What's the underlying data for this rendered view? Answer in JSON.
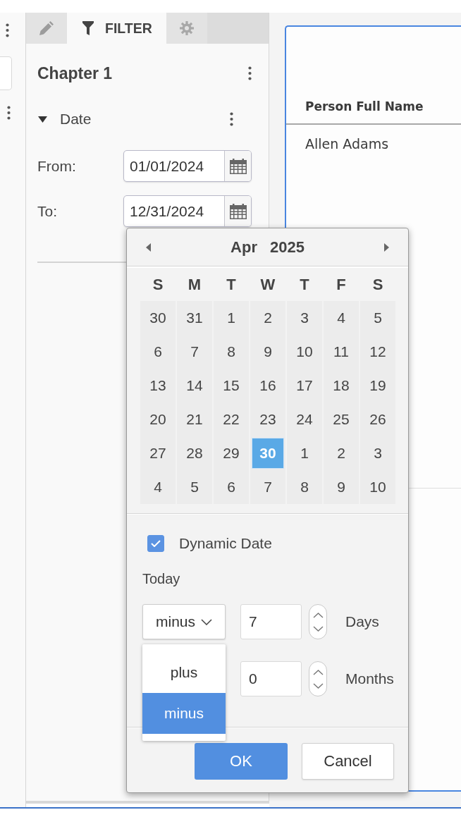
{
  "tabs": [
    {
      "kind": "edit",
      "selected": false
    },
    {
      "kind": "filter",
      "label": "FILTER",
      "selected": true
    },
    {
      "kind": "settings",
      "selected": false
    }
  ],
  "filter_panel": {
    "title": "Chapter 1",
    "section": {
      "label": "Date",
      "expanded": true
    },
    "fields": [
      {
        "label": "From:",
        "value": "01/01/2024"
      },
      {
        "label": "To:",
        "value": "12/31/2024"
      }
    ]
  },
  "table": {
    "columns": [
      "Person Full Name"
    ],
    "rows": [
      [
        "Allen Adams"
      ]
    ]
  },
  "date_picker": {
    "month": "Apr",
    "year": "2025",
    "weekdays": [
      "S",
      "M",
      "T",
      "W",
      "T",
      "F",
      "S"
    ],
    "weeks": [
      [
        {
          "day": "30",
          "selected": false
        },
        {
          "day": "31",
          "selected": false
        },
        {
          "day": "1",
          "selected": false
        },
        {
          "day": "2",
          "selected": false
        },
        {
          "day": "3",
          "selected": false
        },
        {
          "day": "4",
          "selected": false
        },
        {
          "day": "5",
          "selected": false
        }
      ],
      [
        {
          "day": "6",
          "selected": false
        },
        {
          "day": "7",
          "selected": false
        },
        {
          "day": "8",
          "selected": false
        },
        {
          "day": "9",
          "selected": false
        },
        {
          "day": "10",
          "selected": false
        },
        {
          "day": "11",
          "selected": false
        },
        {
          "day": "12",
          "selected": false
        }
      ],
      [
        {
          "day": "13",
          "selected": false
        },
        {
          "day": "14",
          "selected": false
        },
        {
          "day": "15",
          "selected": false
        },
        {
          "day": "16",
          "selected": false
        },
        {
          "day": "17",
          "selected": false
        },
        {
          "day": "18",
          "selected": false
        },
        {
          "day": "19",
          "selected": false
        }
      ],
      [
        {
          "day": "20",
          "selected": false
        },
        {
          "day": "21",
          "selected": false
        },
        {
          "day": "22",
          "selected": false
        },
        {
          "day": "23",
          "selected": false
        },
        {
          "day": "24",
          "selected": false
        },
        {
          "day": "25",
          "selected": false
        },
        {
          "day": "26",
          "selected": false
        }
      ],
      [
        {
          "day": "27",
          "selected": false
        },
        {
          "day": "28",
          "selected": false
        },
        {
          "day": "29",
          "selected": false
        },
        {
          "day": "30",
          "selected": true
        },
        {
          "day": "1",
          "selected": false
        },
        {
          "day": "2",
          "selected": false
        },
        {
          "day": "3",
          "selected": false
        }
      ],
      [
        {
          "day": "4",
          "selected": false
        },
        {
          "day": "5",
          "selected": false
        },
        {
          "day": "6",
          "selected": false
        },
        {
          "day": "7",
          "selected": false
        },
        {
          "day": "8",
          "selected": false
        },
        {
          "day": "9",
          "selected": false
        },
        {
          "day": "10",
          "selected": false
        }
      ]
    ],
    "dynamic_date": {
      "label": "Dynamic Date",
      "checked": true
    },
    "base_label": "Today",
    "direction": {
      "value": "minus",
      "expanded": true,
      "options": [
        {
          "label": "plus",
          "selected": false
        },
        {
          "label": "minus",
          "selected": true
        }
      ]
    },
    "offsets": [
      {
        "value": "7",
        "unit": "Days"
      },
      {
        "value": "0",
        "unit": "Months"
      }
    ],
    "buttons": [
      {
        "label": "OK",
        "kind": "primary"
      },
      {
        "label": "Cancel",
        "kind": "secondary"
      }
    ]
  }
}
